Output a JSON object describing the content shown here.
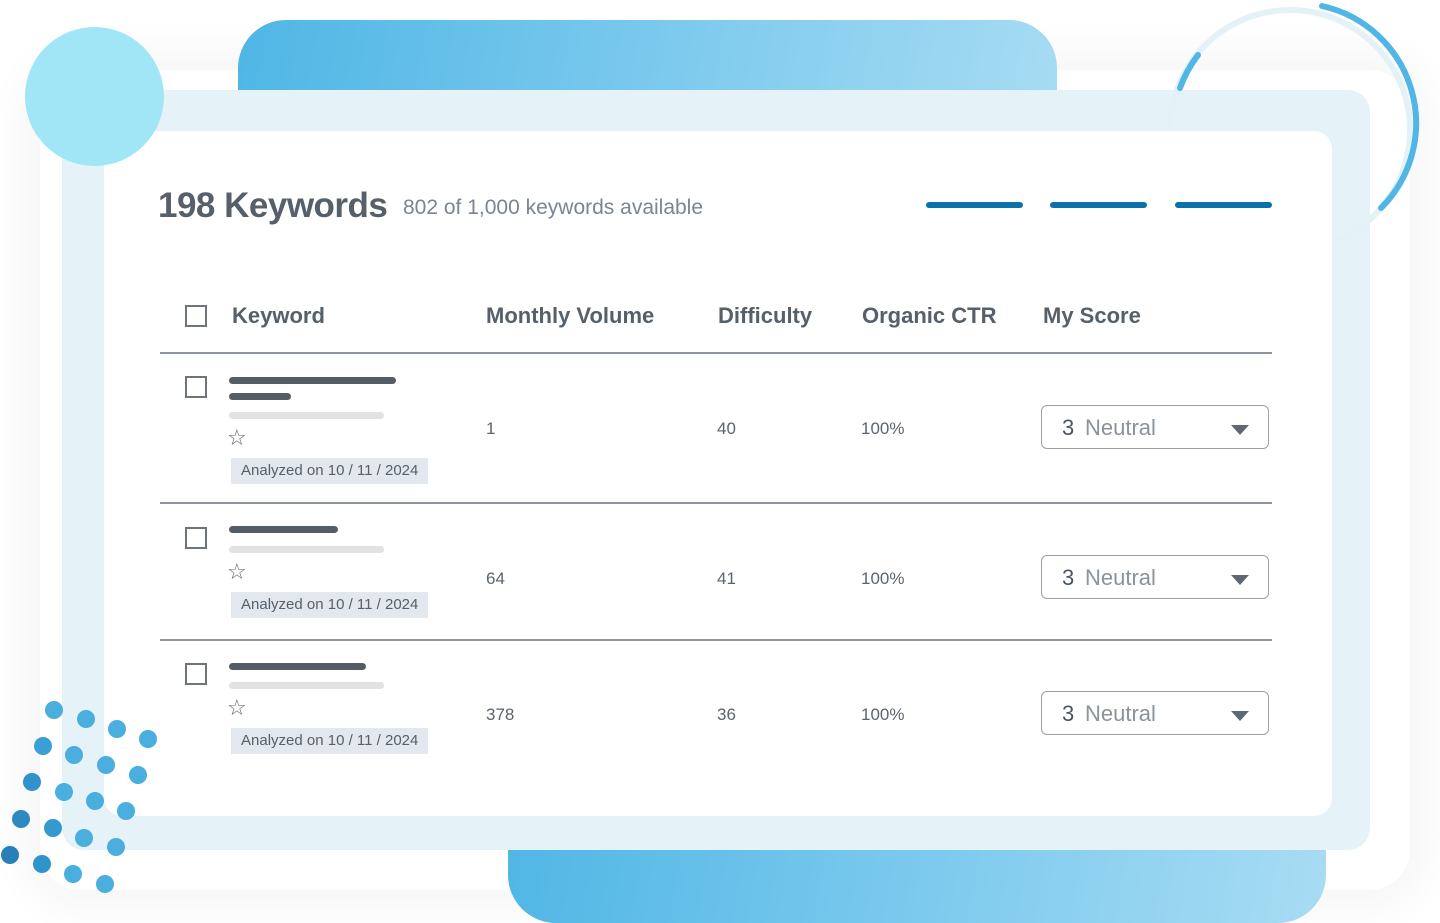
{
  "header": {
    "title": "198 Keywords",
    "subtitle": "802 of 1,000 keywords available"
  },
  "table": {
    "columns": [
      "Keyword",
      "Monthly Volume",
      "Difficulty",
      "Organic CTR",
      "My Score"
    ],
    "rows": [
      {
        "analyzed": "Analyzed on 10 / 11 / 2024",
        "monthly_volume": "1",
        "difficulty": "40",
        "organic_ctr": "100%",
        "score_number": "3",
        "score_label": "Neutral"
      },
      {
        "analyzed": "Analyzed on 10 / 11 / 2024",
        "monthly_volume": "64",
        "difficulty": "41",
        "organic_ctr": "100%",
        "score_number": "3",
        "score_label": "Neutral"
      },
      {
        "analyzed": "Analyzed on 10 / 11 / 2024",
        "monthly_volume": "378",
        "difficulty": "36",
        "organic_ctr": "100%",
        "score_number": "3",
        "score_label": "Neutral"
      }
    ]
  },
  "icons": {
    "star": "☆",
    "checkbox": "checkbox-empty",
    "caret": "caret-down"
  },
  "colors": {
    "accent": "#0a72a8",
    "decor_light_blue": "#a0e6f7",
    "decor_blue": "#4fb6e5",
    "frame": "#e5f3f9",
    "text": "#56606a"
  }
}
